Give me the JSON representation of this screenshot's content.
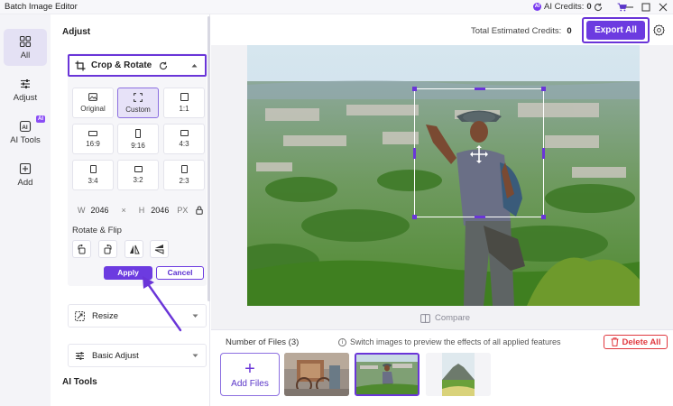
{
  "window": {
    "title": "Batch Image Editor",
    "ai_credits_label": "AI Credits:",
    "ai_credits_value": "0",
    "ai_badge": "AI",
    "colors": {
      "accent": "#6c3be0",
      "danger": "#e0383f"
    }
  },
  "nav": {
    "items": [
      {
        "label": "All",
        "icon": "grid-icon"
      },
      {
        "label": "Adjust",
        "icon": "sliders-icon"
      },
      {
        "label": "AI Tools",
        "icon": "ai-icon",
        "badge": "AI"
      },
      {
        "label": "Add",
        "icon": "plus-square-icon"
      }
    ]
  },
  "panel": {
    "title": "Adjust",
    "crop": {
      "label": "Crop & Rotate",
      "ratios": [
        {
          "label": "Original",
          "selected": false
        },
        {
          "label": "Custom",
          "selected": true
        },
        {
          "label": "1:1",
          "selected": false
        },
        {
          "label": "16:9",
          "selected": false
        },
        {
          "label": "9:16",
          "selected": false
        },
        {
          "label": "4:3",
          "selected": false
        },
        {
          "label": "3:4",
          "selected": false
        },
        {
          "label": "3:2",
          "selected": false
        },
        {
          "label": "2:3",
          "selected": false
        }
      ],
      "width_label": "W",
      "width_value": "2046",
      "times": "×",
      "height_label": "H",
      "height_value": "2046",
      "unit": "PX",
      "rotate_flip_label": "Rotate & Flip",
      "apply_label": "Apply",
      "cancel_label": "Cancel"
    },
    "resize_label": "Resize",
    "basic_adjust_label": "Basic Adjust",
    "ai_tools_heading": "AI Tools"
  },
  "main": {
    "est_credits_label": "Total Estimated Credits:",
    "est_credits_value": "0",
    "export_label": "Export All",
    "compare_label": "Compare",
    "files_label": "Number of Files (3)",
    "hint": "Switch images to preview the effects of all applied features",
    "delete_all_label": "Delete All",
    "add_files_label": "Add Files",
    "add_files_plus": "+"
  }
}
